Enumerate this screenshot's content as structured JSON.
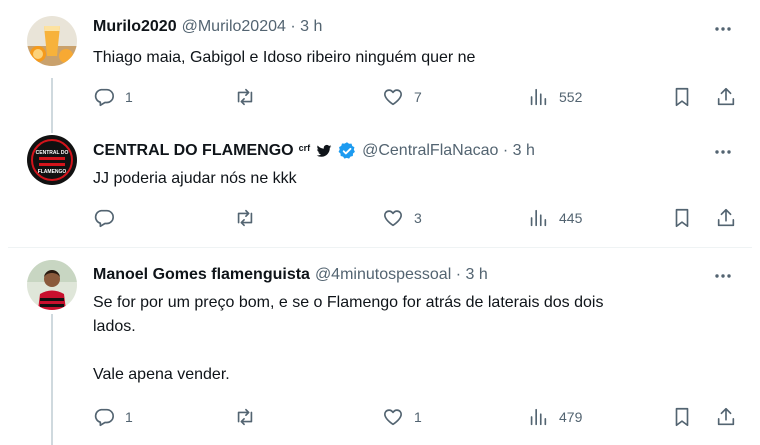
{
  "tweets": [
    {
      "name": "Murilo2020",
      "badges": [],
      "handle_time": "@Murilo20204 · 3 h",
      "text_lines": [
        "Thiago maia, Gabigol  e Idoso ribeiro ninguém quer ne"
      ],
      "replies": "1",
      "retweets": "",
      "likes": "7",
      "views": "552"
    },
    {
      "name": "CENTRAL DO FLAMENGO",
      "badge_crf": "crf",
      "badges": [
        "twitter-bird-icon",
        "verified-badge-icon"
      ],
      "handle_time": "@CentralFlaNacao · 3 h",
      "text_lines": [
        "JJ poderia ajudar nós ne kkk"
      ],
      "replies": "",
      "retweets": "",
      "likes": "3",
      "views": "445",
      "avatar_text": [
        "CENTRAL DO",
        "FLAMENGO"
      ]
    },
    {
      "name": "Manoel Gomes flamenguista",
      "badges": [],
      "handle_time": "@4minutospessoal · 3 h",
      "text_lines": [
        "Se for por um preço bom, e se o Flamengo for atrás de laterais dos dois",
        "lados.",
        "",
        "Vale apena vender."
      ],
      "replies": "1",
      "retweets": "",
      "likes": "1",
      "views": "479"
    }
  ],
  "colors": {
    "text": "#0f1419",
    "secondary": "#536471",
    "verified": "#1d9bf0",
    "thread_line": "#cfd9de",
    "divider": "#eff3f4"
  }
}
